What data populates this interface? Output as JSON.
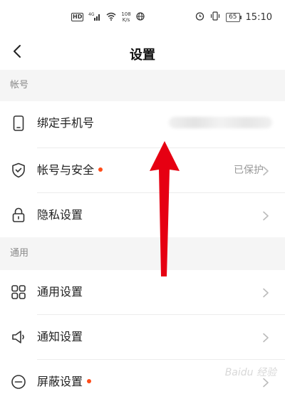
{
  "status_bar": {
    "network_badge": "HD",
    "network_type": "4G",
    "speed_value": "108",
    "speed_unit": "K/s",
    "battery": "65",
    "time": "15:10"
  },
  "nav": {
    "title": "设置"
  },
  "sections": [
    {
      "header": "帐号",
      "items": [
        {
          "label": "绑定手机号",
          "icon": "phone-icon"
        },
        {
          "label": "帐号与安全",
          "value": "已保护",
          "icon": "shield-check-icon",
          "has_dot": true
        },
        {
          "label": "隐私设置",
          "icon": "lock-icon"
        }
      ]
    },
    {
      "header": "通用",
      "items": [
        {
          "label": "通用设置",
          "icon": "grid-icon"
        },
        {
          "label": "通知设置",
          "icon": "speaker-icon"
        },
        {
          "label": "屏蔽设置",
          "icon": "block-icon",
          "has_dot": true
        }
      ]
    }
  ],
  "colors": {
    "dot": "#ff4d1a",
    "arrow": "#e60012",
    "section_bg": "#f5f5f5"
  },
  "watermark": "Baidu 经验"
}
